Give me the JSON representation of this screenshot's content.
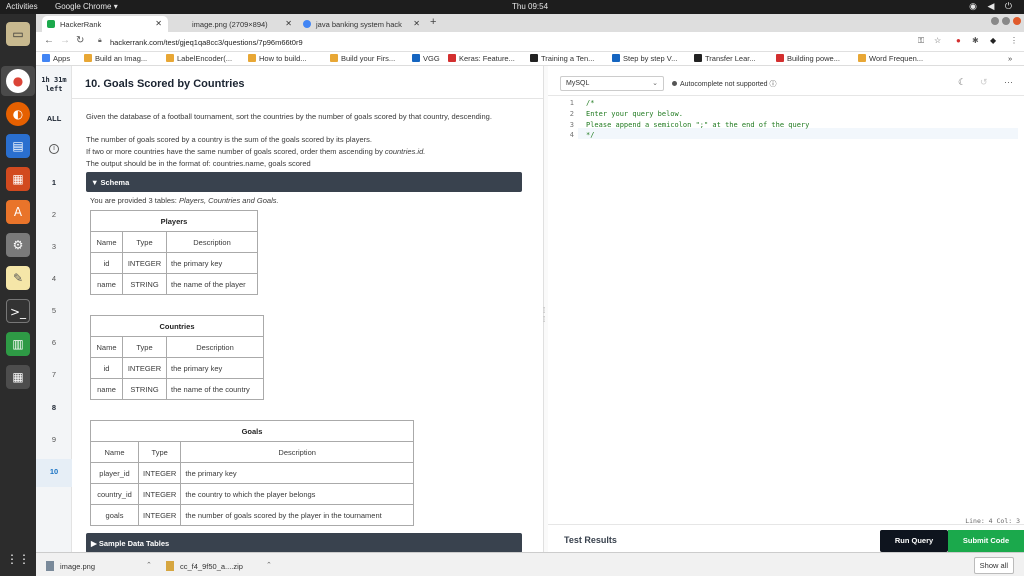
{
  "system": {
    "activities": "Activities",
    "app_name": "Google Chrome ▾",
    "clock": "Thu 09:54"
  },
  "tabs": [
    {
      "title": "HackerRank",
      "active": true
    },
    {
      "title": "image.png (2709×894)",
      "active": false
    },
    {
      "title": "java banking system hack",
      "active": false
    }
  ],
  "address": {
    "url": "hackerrank.com/test/gjeq1qa8cc3/questions/7p96m66t0r9"
  },
  "bookmarks": [
    {
      "label": "Apps",
      "color": "#4285f4"
    },
    {
      "label": "Build an Imag...",
      "color": "#e8a735"
    },
    {
      "label": "LabelEncoder(...",
      "color": "#e8a735"
    },
    {
      "label": "How to build...",
      "color": "#e8a735"
    },
    {
      "label": "Build your Firs...",
      "color": "#e8a735"
    },
    {
      "label": "VGG",
      "color": "#1565c0"
    },
    {
      "label": "Keras: Feature...",
      "color": "#d32f2f"
    },
    {
      "label": "Training a Ten...",
      "color": "#222222"
    },
    {
      "label": "Step by step V...",
      "color": "#1565c0"
    },
    {
      "label": "Transfer Lear...",
      "color": "#222222"
    },
    {
      "label": "Building powe...",
      "color": "#d32f2f"
    },
    {
      "label": "Word Frequen...",
      "color": "#e8a735"
    }
  ],
  "sidebar": {
    "timer": "1h 31m left",
    "all": "ALL",
    "questions": [
      "1",
      "2",
      "3",
      "4",
      "5",
      "6",
      "7",
      "8",
      "9",
      "10"
    ]
  },
  "problem": {
    "title": "10. Goals Scored by Countries",
    "desc1": "Given the database of a football tournament, sort the countries by the number of goals scored by that country, descending.",
    "desc2": "The number of goals scored by a country is the sum of the goals scored by its players.",
    "desc3a": "If two or more countries have the same number of goals scored, order them ascending by ",
    "desc3b": "countries.id.",
    "desc4": "The output should be in the format of: countries.name, goals scored",
    "schema_label": "▼ Schema",
    "provided_prefix": "You are provided 3 tables: ",
    "provided_tables": "Players, Countries and Goals.",
    "sample_label": "▶ Sample Data Tables",
    "tables": {
      "players": {
        "name": "Players",
        "headers": [
          "Name",
          "Type",
          "Description"
        ],
        "rows": [
          [
            "id",
            "INTEGER",
            "the primary key"
          ],
          [
            "name",
            "STRING",
            "the name of the player"
          ]
        ]
      },
      "countries": {
        "name": "Countries",
        "headers": [
          "Name",
          "Type",
          "Description"
        ],
        "rows": [
          [
            "id",
            "INTEGER",
            "the primary key"
          ],
          [
            "name",
            "STRING",
            "the name of the country"
          ]
        ]
      },
      "goals": {
        "name": "Goals",
        "headers": [
          "Name",
          "Type",
          "Description"
        ],
        "rows": [
          [
            "player_id",
            "INTEGER",
            "the primary key"
          ],
          [
            "country_id",
            "INTEGER",
            "the country to which the player belongs"
          ],
          [
            "goals",
            "INTEGER",
            "the number of goals scored by the player in the tournament"
          ]
        ]
      }
    }
  },
  "editor": {
    "language": "MySQL",
    "autocomplete": "Autocomplete not supported",
    "lines": [
      {
        "num": "1",
        "text": "/*"
      },
      {
        "num": "2",
        "text": "Enter your query below."
      },
      {
        "num": "3",
        "text": "Please append a semicolon \";\" at the end of the query"
      },
      {
        "num": "4",
        "text": "*/"
      }
    ],
    "line_col": "Line: 4 Col: 3",
    "test_results": "Test Results",
    "run_label": "Run Query",
    "submit_label": "Submit Code"
  },
  "downloads": {
    "items": [
      {
        "name": "image.png"
      },
      {
        "name": "cc_f4_9f50_a....zip"
      }
    ],
    "show_all": "Show all"
  }
}
